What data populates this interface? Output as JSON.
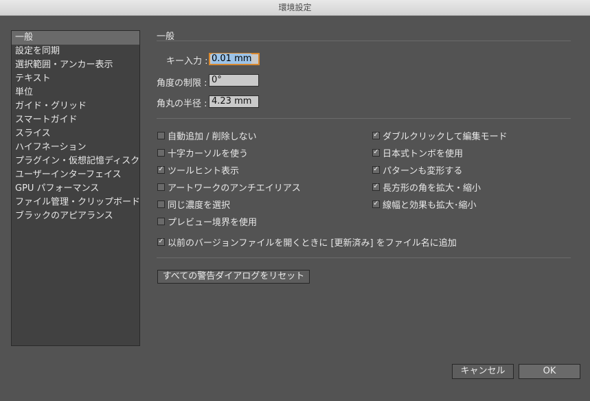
{
  "window": {
    "title": "環境設定"
  },
  "sidebar": {
    "selected_index": 0,
    "items": [
      "一般",
      "設定を同期",
      "選択範囲・アンカー表示",
      "テキスト",
      "単位",
      "ガイド・グリッド",
      "スマートガイド",
      "スライス",
      "ハイフネーション",
      "プラグイン・仮想記憶ディスク",
      "ユーザーインターフェイス",
      "GPU パフォーマンス",
      "ファイル管理・クリップボード",
      "ブラックのアピアランス"
    ]
  },
  "general": {
    "title": "一般",
    "keyboard_increment": {
      "label": "キー入力 :",
      "value": "0.01 mm"
    },
    "constrain_angle": {
      "label": "角度の制限 :",
      "value": "0°"
    },
    "corner_radius": {
      "label": "角丸の半径 :",
      "value": "4.23 mm"
    },
    "checkboxes_left": [
      {
        "label": "自動追加 / 削除しない",
        "checked": false
      },
      {
        "label": "十字カーソルを使う",
        "checked": false
      },
      {
        "label": "ツールヒント表示",
        "checked": true
      },
      {
        "label": "アートワークのアンチエイリアス",
        "checked": false
      },
      {
        "label": "同じ濃度を選択",
        "checked": false
      },
      {
        "label": "プレビュー境界を使用",
        "checked": false
      }
    ],
    "checkboxes_right": [
      {
        "label": "ダブルクリックして編集モード",
        "checked": true
      },
      {
        "label": "日本式トンボを使用",
        "checked": true
      },
      {
        "label": "パターンも変形する",
        "checked": true
      },
      {
        "label": "長方形の角を拡大・縮小",
        "checked": true
      },
      {
        "label": "線幅と効果も拡大･縮小",
        "checked": true
      }
    ],
    "append_updated": {
      "label": "以前のバージョンファイルを開くときに [更新済み] をファイル名に追加",
      "checked": true
    },
    "reset_warnings_label": "すべての警告ダイアログをリセット"
  },
  "buttons": {
    "cancel": "キャンセル",
    "ok": "OK"
  },
  "check_glyph": "✓"
}
